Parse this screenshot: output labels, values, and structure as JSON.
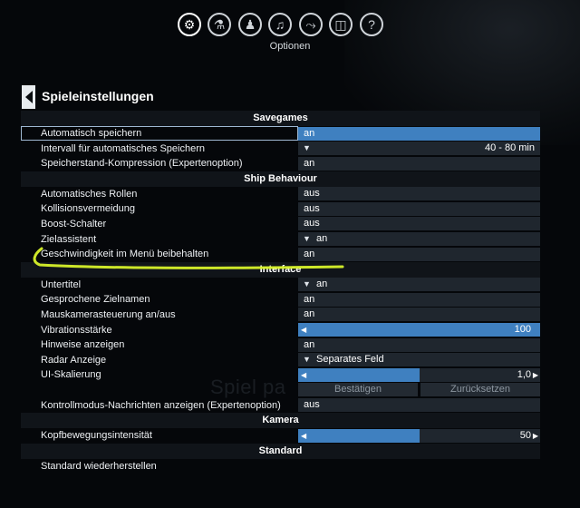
{
  "nav": {
    "items": [
      {
        "icon": "gear-icon",
        "glyph": "⚙"
      },
      {
        "icon": "flask-icon",
        "glyph": "⚗"
      },
      {
        "icon": "person-icon",
        "glyph": "♟"
      },
      {
        "icon": "headset-icon",
        "glyph": "♫"
      },
      {
        "icon": "route-icon",
        "glyph": "⤳"
      },
      {
        "icon": "book-icon",
        "glyph": "◫"
      },
      {
        "icon": "help-icon",
        "glyph": "?"
      }
    ],
    "label": "Optionen"
  },
  "header": {
    "title": "Spieleinstellungen"
  },
  "watermark": "Spiel pa",
  "sections": {
    "savegames": "Savegames",
    "ship": "Ship Behaviour",
    "interface": "Interface",
    "kamera": "Kamera",
    "standard": "Standard"
  },
  "rows": {
    "autosave": {
      "label": "Automatisch speichern",
      "value": "an"
    },
    "autosave_interval": {
      "label": "Intervall für automatisches Speichern",
      "value": "40 - 80 min"
    },
    "compression": {
      "label": "Speicherstand-Kompression (Expertenoption)",
      "value": "an"
    },
    "autoroll": {
      "label": "Automatisches Rollen",
      "value": "aus"
    },
    "collision": {
      "label": "Kollisionsvermeidung",
      "value": "aus"
    },
    "boost": {
      "label": "Boost-Schalter",
      "value": "aus"
    },
    "target_assist": {
      "label": "Zielassistent",
      "value": "an"
    },
    "keep_speed": {
      "label": "Geschwindigkeit im Menü beibehalten",
      "value": "an"
    },
    "subtitles": {
      "label": "Untertitel",
      "value": "an"
    },
    "target_names": {
      "label": "Gesprochene Zielnamen",
      "value": "an"
    },
    "mouse_camera": {
      "label": "Mauskamerasteuerung an/aus",
      "value": "an"
    },
    "vibration": {
      "label": "Vibrationsstärke",
      "value": "100",
      "level": 1.0
    },
    "hints": {
      "label": "Hinweise anzeigen",
      "value": "an"
    },
    "radar": {
      "label": "Radar Anzeige",
      "value": "Separates Feld"
    },
    "ui_scale": {
      "label": "UI-Skalierung",
      "value": "1,0",
      "level": 0.5
    },
    "control_msgs": {
      "label": "Kontrollmodus-Nachrichten anzeigen (Expertenoption)",
      "value": "aus"
    },
    "head_bob": {
      "label": "Kopfbewegungsintensität",
      "value": "50",
      "level": 0.5
    },
    "restore": {
      "label": "Standard wiederherstellen"
    }
  },
  "buttons": {
    "confirm": "Bestätigen",
    "reset": "Zurücksetzen"
  },
  "colors": {
    "accent": "#3f80c0",
    "marker": "#d8f22a"
  }
}
